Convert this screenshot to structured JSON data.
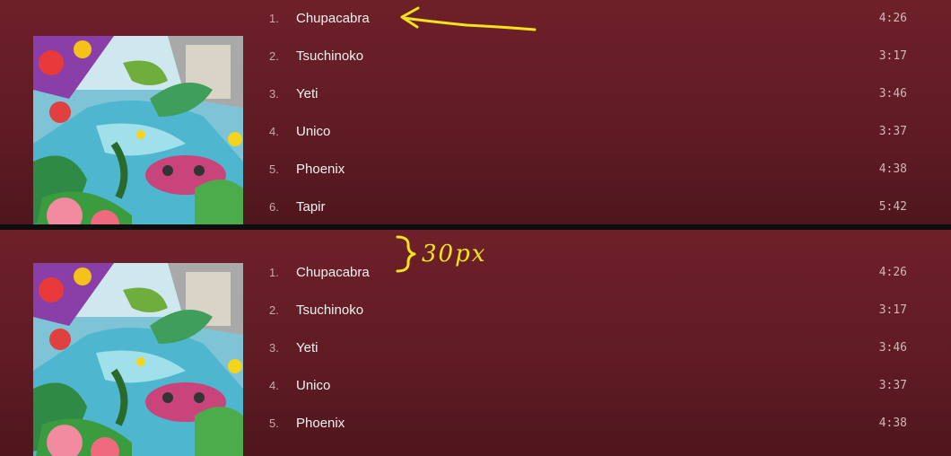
{
  "tracks_top": [
    {
      "number": "1.",
      "title": "Chupacabra",
      "duration": "4:26"
    },
    {
      "number": "2.",
      "title": "Tsuchinoko",
      "duration": "3:17"
    },
    {
      "number": "3.",
      "title": "Yeti",
      "duration": "3:46"
    },
    {
      "number": "4.",
      "title": "Unico",
      "duration": "3:37"
    },
    {
      "number": "5.",
      "title": "Phoenix",
      "duration": "4:38"
    },
    {
      "number": "6.",
      "title": "Tapir",
      "duration": "5:42"
    }
  ],
  "tracks_bottom": [
    {
      "number": "1.",
      "title": "Chupacabra",
      "duration": "4:26"
    },
    {
      "number": "2.",
      "title": "Tsuchinoko",
      "duration": "3:17"
    },
    {
      "number": "3.",
      "title": "Yeti",
      "duration": "3:46"
    },
    {
      "number": "4.",
      "title": "Unico",
      "duration": "3:37"
    },
    {
      "number": "5.",
      "title": "Phoenix",
      "duration": "4:38"
    }
  ],
  "annotation": {
    "spacing_label": "30px",
    "marker_color": "#f4e31a"
  },
  "colors": {
    "background": "#6e2029",
    "divider": "#0d0d0d"
  }
}
